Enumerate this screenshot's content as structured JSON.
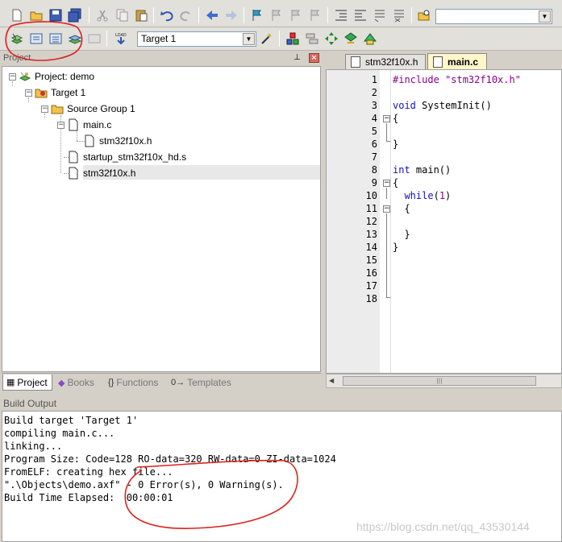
{
  "toolbar": {
    "target_label": "Target 1",
    "search_value": ""
  },
  "project_panel": {
    "title": "Project",
    "tree": {
      "root": "Project: demo",
      "target": "Target 1",
      "group": "Source Group 1",
      "file_main": "main.c",
      "file_main_dep": "stm32f10x.h",
      "file_startup": "startup_stm32f10x_hd.s",
      "file_header": "stm32f10x.h"
    },
    "bottom_tabs": [
      "Project",
      "Books",
      "Functions",
      "Templates"
    ]
  },
  "editor": {
    "tabs": [
      "stm32f10x.h",
      "main.c"
    ],
    "active_tab": "main.c",
    "line_numbers": [
      "1",
      "2",
      "3",
      "4",
      "5",
      "6",
      "7",
      "8",
      "9",
      "10",
      "11",
      "12",
      "13",
      "14",
      "15",
      "16",
      "17",
      "18"
    ],
    "code": {
      "l1_pp": "#include",
      "l1_str": "\"stm32f10x.h\"",
      "l3_kw": "void",
      "l3_rest": " SystemInit()",
      "l4": "{",
      "l6": "}",
      "l8_kw": "int",
      "l8_rest": " main()",
      "l9": "{",
      "l10_kw": "  while",
      "l10_p1": "(",
      "l10_num": "1",
      "l10_p2": ")",
      "l11": "  {",
      "l13": "  }",
      "l14": "}"
    }
  },
  "build_output": {
    "title": "Build Output",
    "lines": [
      "Build target 'Target 1'",
      "compiling main.c...",
      "linking...",
      "Program Size: Code=128 RO-data=320 RW-data=0 ZI-data=1024",
      "FromELF: creating hex file...",
      "\".\\Objects\\demo.axf\" - 0 Error(s), 0 Warning(s).",
      "Build Time Elapsed:  00:00:01"
    ]
  },
  "watermark": "https://blog.csdn.net/qq_43530144",
  "colors": {
    "annotation": "#e0201c",
    "active_tab": "#fff6c9",
    "keyword": "#1010c0",
    "preprocessor": "#8a008a"
  }
}
